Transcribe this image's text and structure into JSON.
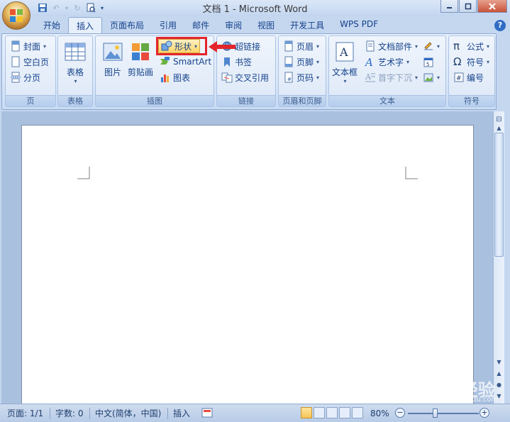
{
  "window": {
    "title": "文档 1 - Microsoft Word"
  },
  "tabs": [
    {
      "label": "开始"
    },
    {
      "label": "插入"
    },
    {
      "label": "页面布局"
    },
    {
      "label": "引用"
    },
    {
      "label": "邮件"
    },
    {
      "label": "审阅"
    },
    {
      "label": "视图"
    },
    {
      "label": "开发工具"
    },
    {
      "label": "WPS PDF"
    }
  ],
  "ribbon": {
    "pages": {
      "label": "页",
      "cover": "封面",
      "blank": "空白页",
      "break": "分页"
    },
    "tables": {
      "label": "表格",
      "table": "表格"
    },
    "illustrations": {
      "label": "插图",
      "picture": "图片",
      "clipart": "剪贴画",
      "shapes": "形状",
      "smartart": "SmartArt",
      "chart": "图表"
    },
    "links": {
      "label": "链接",
      "hyperlink": "超链接",
      "bookmark": "书签",
      "crossref": "交叉引用"
    },
    "header_footer": {
      "label": "页眉和页脚",
      "header": "页眉",
      "footer": "页脚",
      "page_number": "页码"
    },
    "text": {
      "label": "文本",
      "textbox": "文本框",
      "quick_parts": "文档部件",
      "wordart": "艺术字",
      "drop_cap": "首字下沉"
    },
    "symbols": {
      "label": "符号",
      "equation": "公式",
      "symbol": "符号",
      "number": "编号"
    }
  },
  "status": {
    "page": "页面: 1/1",
    "words": "字数: 0",
    "language": "中文(简体，中国)",
    "mode": "插入",
    "zoom": "80%",
    "zoom_level": 0.8
  },
  "watermark": {
    "brand": "Bai du 经验",
    "url": "jingyan.baidu.com"
  }
}
